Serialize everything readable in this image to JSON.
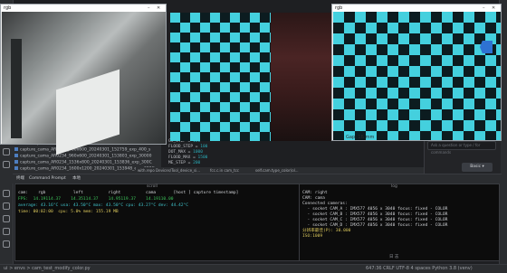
{
  "windows": {
    "left_title": "rgb",
    "right_title": "rgb",
    "right_badge": "Gap: 1Б mm"
  },
  "file_tree": [
    "camls.mp4",
    "capture_cama_AR0234_960x600_20240301_152759_exp_400_s",
    "capture_cama_AR0234_960x600_20240301_153803_exp_30000",
    "capture_cama_AR0234_1536x800_20240301_153836_exp_300C",
    "capture_cama_AR0234_1600x1200_20240301_153948_exp_300C"
  ],
  "code": [
    {
      "k": "GV_STEP",
      "v": "100"
    },
    {
      "k": "FLOOD_STEP",
      "v": "100"
    },
    {
      "k": "DOT_MAX",
      "v": "1000"
    },
    {
      "k": "FLOOD_MAX",
      "v": "1500"
    },
    {
      "k": "ME_STEP",
      "v": "200"
    }
  ],
  "editor_tabs": [
    "with.repo Devices/Tool_device_si...",
    "fcc.c.in cam_tcc",
    "self.cam.type_color(ol..."
  ],
  "chat": {
    "placeholder": "Ask a question or type / for commands",
    "send": "Basic ▾"
  },
  "terminal_tabs": [
    "终端",
    "Command Prompt",
    "本地"
  ],
  "pane_left": {
    "title": "scroll",
    "lines": [
      "cam:    rgb           left          right          cama       [host ] capture timestamp]",
      "FPS:  14.19114.37    14.35114.37    14.95119.37    14.19110.00",
      "average: 43.16°C usa: 43.50°C max: 43.50°C cpu: 43.27°C dev: 44.42°C",
      "time: 00:02:00  cpu: 5.0% mem: 155.19 MB"
    ]
  },
  "pane_right": {
    "title": "log",
    "lines": [
      "CAM: right",
      "CAM: cama",
      "Connected cameras:",
      "  - socket CAM_A : IMX577 4056 x 3040 focus: fixed - COLOR",
      "  - socket CAM_B : IMX577 4056 x 3040 focus: fixed - COLOR",
      "  - socket CAM_C : IMX577 4056 x 3040 focus: fixed - COLOR",
      "  - socket CAM_D : IMX577 4056 x 3040 focus: fixed - COLOR",
      "分辨率最佳(P): 30.000",
      "ISO:1009"
    ],
    "footer": "日 志"
  },
  "statusbar": {
    "left": "ui > envs  >  cam_test_modify_color.py",
    "right": "647:36   CRLF   UTF-8   4 spaces   Python 3.8 (venv)"
  }
}
